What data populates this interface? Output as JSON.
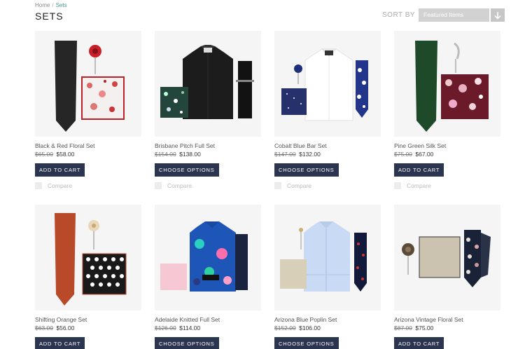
{
  "breadcrumb": {
    "home": "Home",
    "separator": "/",
    "current": "Sets"
  },
  "page_title": "SETS",
  "sort": {
    "label": "SORT BY",
    "selected": "Featured Items",
    "button_icon": "arrow-down-icon"
  },
  "colors": {
    "button_bg": "#2c3550",
    "accent": "#4a9a8a"
  },
  "compare_label": "Compare",
  "products": [
    {
      "name": "Black & Red Floral Set",
      "old_price": "$65.00",
      "price": "$58.00",
      "button": "ADD TO CART",
      "image": "black-tie-red-flower-floral-pocket-square"
    },
    {
      "name": "Brisbane Pitch Full Set",
      "old_price": "$154.00",
      "price": "$138.00",
      "button": "CHOOSE OPTIONS",
      "image": "black-shirt-tie-pocket-square"
    },
    {
      "name": "Cobalt Blue Bar Set",
      "old_price": "$147.00",
      "price": "$132.00",
      "button": "CHOOSE OPTIONS",
      "image": "white-shirt-blue-tie-pocket-square"
    },
    {
      "name": "Pine Green Silk Set",
      "old_price": "$75.00",
      "price": "$67.00",
      "button": "ADD TO CART",
      "image": "green-tie-floral-pocket-square"
    },
    {
      "name": "Shifting Orange Set",
      "old_price": "$63.00",
      "price": "$56.00",
      "button": "ADD TO CART",
      "image": "orange-tie-flower-patterned-pocket-square"
    },
    {
      "name": "Adelaide Knitted Full Set",
      "old_price": "$126.00",
      "price": "$114.00",
      "button": "CHOOSE OPTIONS",
      "image": "blue-floral-shirt-pink-pocket-square"
    },
    {
      "name": "Arizona Blue Poplin Set",
      "old_price": "$152.00",
      "price": "$106.00",
      "button": "CHOOSE OPTIONS",
      "image": "light-blue-shirt-navy-tie"
    },
    {
      "name": "Arizona Vintage Floral Set",
      "old_price": "$87.00",
      "price": "$75.00",
      "button": "ADD TO CART",
      "image": "linen-pocket-square-floral-tie"
    }
  ]
}
